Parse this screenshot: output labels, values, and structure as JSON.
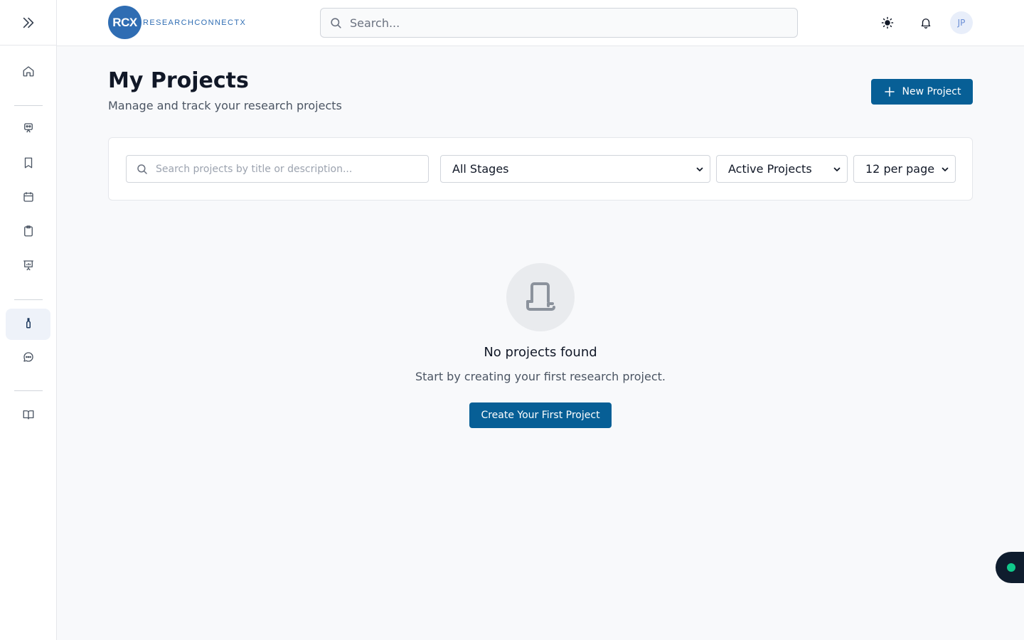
{
  "brand": {
    "logo_initials": "RCX",
    "logo_text": "RESEARCHCONNECTX",
    "color": "#2f6db3"
  },
  "header": {
    "search_placeholder": "Search...",
    "avatar_initials": "JP",
    "icons": [
      "sun-icon",
      "bell-icon"
    ]
  },
  "sidebar": {
    "toggle_icon": "chevrons-right-icon",
    "items": [
      {
        "name": "home",
        "icon": "home-icon",
        "active": false
      },
      {
        "name": "mentors",
        "icon": "presenter-icon",
        "active": false
      },
      {
        "name": "bookmarks",
        "icon": "bookmark-icon",
        "active": false
      },
      {
        "name": "calendar",
        "icon": "calendar-icon",
        "active": false
      },
      {
        "name": "tasks",
        "icon": "clipboard-icon",
        "active": false
      },
      {
        "name": "presentations",
        "icon": "presentation-chart-icon",
        "active": false
      },
      {
        "name": "projects",
        "icon": "flask-icon",
        "active": true
      },
      {
        "name": "messages",
        "icon": "chat-icon",
        "active": false
      },
      {
        "name": "resources",
        "icon": "book-open-icon",
        "active": false
      }
    ]
  },
  "page": {
    "title": "My Projects",
    "subtitle": "Manage and track your research projects",
    "new_project_label": "New Project"
  },
  "filters": {
    "search_placeholder": "Search projects by title or description...",
    "stage_value": "All Stages",
    "status_value": "Active Projects",
    "per_page_value": "12 per page"
  },
  "empty_state": {
    "icon": "scroll-icon",
    "title": "No projects found",
    "message": "Start by creating your first research project.",
    "cta_label": "Create Your First Project"
  },
  "colors": {
    "primary": "#075f96",
    "status_dot": "#10c98b"
  }
}
